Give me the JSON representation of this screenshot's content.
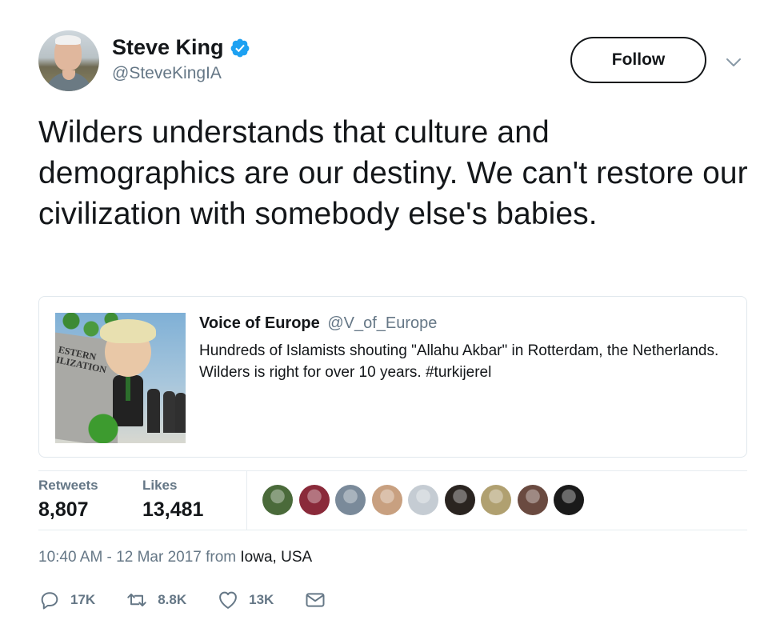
{
  "author": {
    "name": "Steve King",
    "handle": "@SteveKingIA",
    "verified": true
  },
  "follow_button": {
    "label": "Follow"
  },
  "tweet": {
    "text": "Wilders understands that culture and demographics are our destiny. We can't restore our civilization with somebody else's babies."
  },
  "quoted_tweet": {
    "author_name": "Voice of Europe",
    "author_handle": "@V_of_Europe",
    "text": "Hundreds of Islamists shouting \"Allahu Akbar\" in Rotterdam, the Netherlands. Wilders is right for over 10 years. #turkijerel",
    "image_text_line1": "ESTERN",
    "image_text_line2": "ILIZATION"
  },
  "stats": {
    "retweets_label": "Retweets",
    "retweets_value": "8,807",
    "likes_label": "Likes",
    "likes_value": "13,481"
  },
  "likers": [
    {
      "name": "liker-1",
      "color": "#4a6a3a"
    },
    {
      "name": "liker-2",
      "color": "#8a2a3a"
    },
    {
      "name": "liker-3",
      "color": "#7a8a9a"
    },
    {
      "name": "liker-4",
      "color": "#c8a080"
    },
    {
      "name": "liker-5",
      "color": "#c5ccd3"
    },
    {
      "name": "liker-6",
      "color": "#2a2420"
    },
    {
      "name": "liker-7",
      "color": "#b0a070"
    },
    {
      "name": "liker-8",
      "color": "#6a4a40"
    },
    {
      "name": "liker-9",
      "color": "#1a1a1a"
    }
  ],
  "timestamp": {
    "time_date": "10:40 AM - 12 Mar 2017",
    "from": "from",
    "location": "Iowa, USA"
  },
  "actions": {
    "reply_count": "17K",
    "retweet_count": "8.8K",
    "like_count": "13K"
  },
  "colors": {
    "verified_blue": "#1da1f2",
    "secondary_text": "#657786",
    "primary_text": "#14171a"
  }
}
